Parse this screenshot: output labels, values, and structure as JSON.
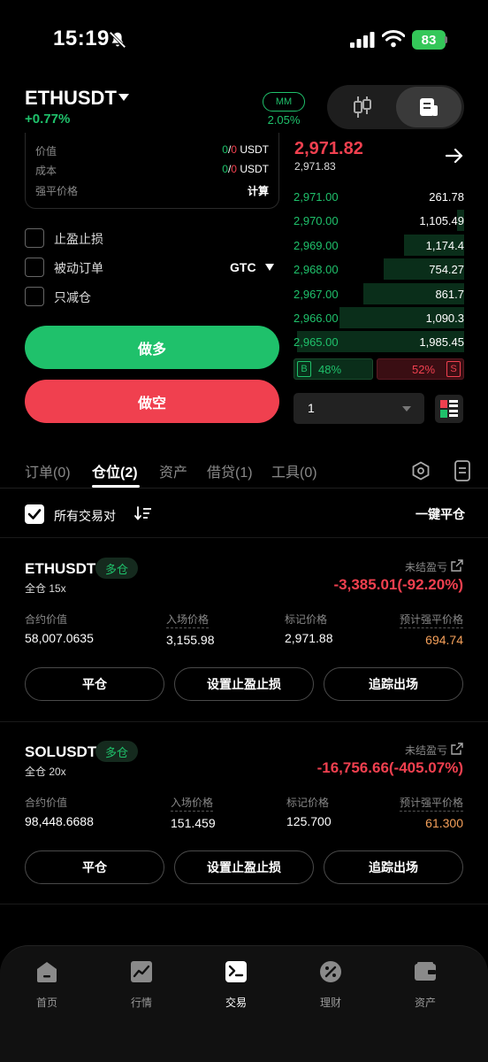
{
  "status_bar": {
    "time": "15:19",
    "battery": "83"
  },
  "header": {
    "symbol": "ETHUSDT",
    "change": "+0.77%",
    "mm_label": "MM",
    "mm_value": "2.05%"
  },
  "info": {
    "rows": [
      {
        "label": "价值",
        "used": "0",
        "total": "0",
        "unit": "USDT"
      },
      {
        "label": "成本",
        "used": "0",
        "total": "0",
        "unit": "USDT"
      },
      {
        "label": "强平价格",
        "value": "计算"
      }
    ],
    "sep": "/"
  },
  "options": {
    "tp_sl": "止盈止损",
    "post_only": "被动订单",
    "reduce_only": "只减仓",
    "tif": "GTC"
  },
  "actions": {
    "long": "做多",
    "short": "做空"
  },
  "orderbook": {
    "last_price": "2,971.82",
    "mark_price": "2,971.83",
    "bids": [
      {
        "price": "2,971.00",
        "qty": "261.78",
        "depth": 0.0
      },
      {
        "price": "2,970.00",
        "qty": "1,105.49",
        "depth": 0.04
      },
      {
        "price": "2,969.00",
        "qty": "1,174.4",
        "depth": 0.35
      },
      {
        "price": "2,968.00",
        "qty": "754.27",
        "depth": 0.47
      },
      {
        "price": "2,967.00",
        "qty": "861.7",
        "depth": 0.59
      },
      {
        "price": "2,966.00",
        "qty": "1,090.3",
        "depth": 0.73
      },
      {
        "price": "2,965.00",
        "qty": "1,985.45",
        "depth": 0.98
      }
    ],
    "buy_tag": "B",
    "buy_pct": "48%",
    "sell_pct": "52%",
    "sell_tag": "S",
    "depth_value": "1"
  },
  "tabs": [
    {
      "label": "订单(0)"
    },
    {
      "label": "仓位(2)"
    },
    {
      "label": "资产"
    },
    {
      "label": "借贷(1)"
    },
    {
      "label": "工具(0)"
    }
  ],
  "filter": {
    "all_pairs": "所有交易对",
    "close_all": "一键平仓"
  },
  "labels": {
    "unrealized": "未结盈亏",
    "contract_value": "合约价值",
    "entry_price": "入场价格",
    "mark_price": "标记价格",
    "liq_price": "预计强平价格",
    "close_btn": "平仓",
    "tpsl_btn": "设置止盈止损",
    "trail_btn": "追踪出场"
  },
  "positions": [
    {
      "symbol": "ETHUSDT",
      "side": "多仓",
      "mode": "全仓 15x",
      "pnl": "-3,385.01(-92.20%)",
      "contract_value": "58,007.0635",
      "entry_price": "3,155.98",
      "mark_price": "2,971.88",
      "liq_price": "694.74"
    },
    {
      "symbol": "SOLUSDT",
      "side": "多仓",
      "mode": "全仓 20x",
      "pnl": "-16,756.66(-405.07%)",
      "contract_value": "98,448.6688",
      "entry_price": "151.459",
      "mark_price": "125.700",
      "liq_price": "61.300"
    }
  ],
  "nav": [
    {
      "label": "首页",
      "icon": "home-icon"
    },
    {
      "label": "行情",
      "icon": "chart-icon"
    },
    {
      "label": "交易",
      "icon": "trade-icon"
    },
    {
      "label": "理财",
      "icon": "earn-icon"
    },
    {
      "label": "资产",
      "icon": "wallet-icon"
    }
  ],
  "colors": {
    "green": "#1fc16b",
    "red": "#f0404f",
    "orange": "#f5a05a"
  }
}
